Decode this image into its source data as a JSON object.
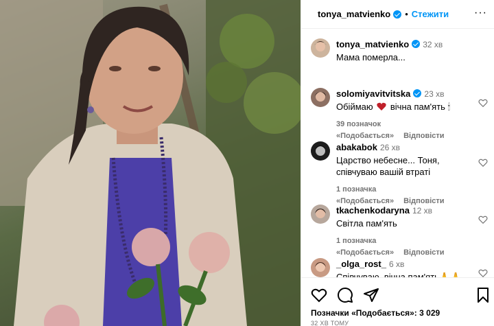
{
  "post": {
    "author": "tonya_matvienko",
    "follow_label": "Стежити",
    "separator": "•",
    "more_label": "···"
  },
  "caption": {
    "author": "tonya_matvienko",
    "time": "32 хв",
    "text": "Мама померла..."
  },
  "comments": [
    {
      "user": "solomiyavitvitska",
      "verified": true,
      "time": "23 хв",
      "text_before": "Обіймаю",
      "text_after": "вічна пам'ять 🕯",
      "likes": "39 позначок «Подобається»",
      "reply": "Відповісти"
    },
    {
      "user": "abakabok",
      "verified": false,
      "time": "26 хв",
      "text": "Царство небесне... Тоня, співчуваю вашій втраті",
      "likes": "1 позначка «Подобається»",
      "reply": "Відповісти"
    },
    {
      "user": "tkachenkodaryna",
      "verified": false,
      "time": "12 хв",
      "text": "Світла пам'ять",
      "likes": "1 позначка «Подобається»",
      "reply": "Відповісти"
    },
    {
      "user": "_olga_rost_",
      "verified": false,
      "time": "6 хв",
      "text": "Співчуваю, вічна пам'ять🙏🙏"
    }
  ],
  "footer": {
    "likes_text": "Позначки «Подобається»: 3 029",
    "time_ago": "32 ХВ ТОМУ"
  },
  "icons": {
    "like": "heart-icon",
    "comment": "comment-icon",
    "share": "send-icon",
    "save": "bookmark-icon"
  },
  "colors": {
    "accent": "#0095f6",
    "muted": "#737373",
    "heart_red": "#c0202a"
  }
}
